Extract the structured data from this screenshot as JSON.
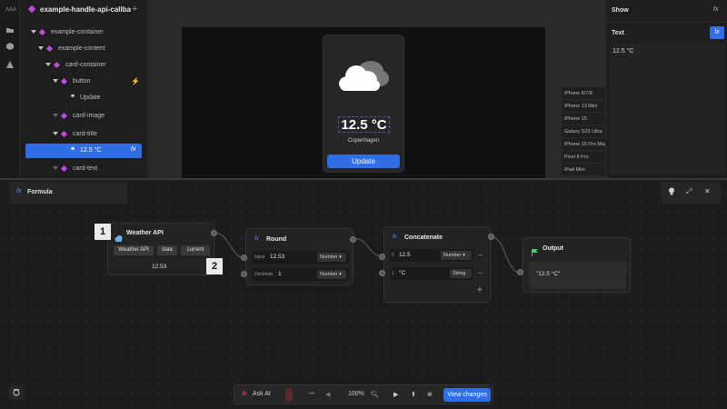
{
  "rail": {
    "icons": [
      "aaa-icon",
      "folder-icon",
      "component-icon",
      "warning-icon"
    ],
    "top_label": "AAA"
  },
  "tree": {
    "title": "example-handle-api-callback",
    "add_label": "+",
    "items": [
      {
        "label": "example-container",
        "type": "component"
      },
      {
        "label": "example-content",
        "type": "component"
      },
      {
        "label": "card-container",
        "type": "component"
      },
      {
        "label": "button",
        "type": "component"
      },
      {
        "label": "Update",
        "type": "text"
      },
      {
        "label": "card-image",
        "type": "component"
      },
      {
        "label": "card-title",
        "type": "component"
      },
      {
        "label": "12.5 °C",
        "type": "text",
        "selected": true
      },
      {
        "label": "card-text",
        "type": "component"
      }
    ],
    "fx_label": "fx"
  },
  "preview": {
    "temperature": "12.5 °C",
    "city": "Copenhagen",
    "button_label": "Update",
    "devices": [
      "iPhone 6/7/8",
      "iPhone 13 Mini",
      "iPhone 15",
      "Galaxy S23 Ultra",
      "iPhone 15 Pro Max",
      "Pixel 8 Pro",
      "iPad Mini"
    ]
  },
  "right_panel": {
    "title": "Show",
    "fx": "fx",
    "field_label": "Text",
    "field_value": "12.5 °C"
  },
  "formula": {
    "title": "Formula",
    "fx": "fx",
    "nodes": {
      "weather": {
        "title": "Weather API",
        "path": [
          "Weather API",
          "data",
          "current"
        ],
        "value": "12.53"
      },
      "round": {
        "title": "Round",
        "input_label": "Input",
        "input_value": "12.53",
        "input_type": "Number",
        "decimals_label": "Decimals",
        "decimals_value": "1",
        "decimals_type": "Number"
      },
      "concat": {
        "title": "Concatenate",
        "rows": [
          {
            "index": "0",
            "value": "12.5",
            "type": "Number"
          },
          {
            "index": "1",
            "value": "°C",
            "type": "String"
          }
        ],
        "add": "+"
      },
      "output": {
        "title": "Output",
        "value": "\"12.5 °C\""
      }
    },
    "badges": [
      "1",
      "2"
    ]
  },
  "toolbar": {
    "ask_ai": "Ask AI",
    "zoom": "100%",
    "view_changes": "View changes"
  }
}
